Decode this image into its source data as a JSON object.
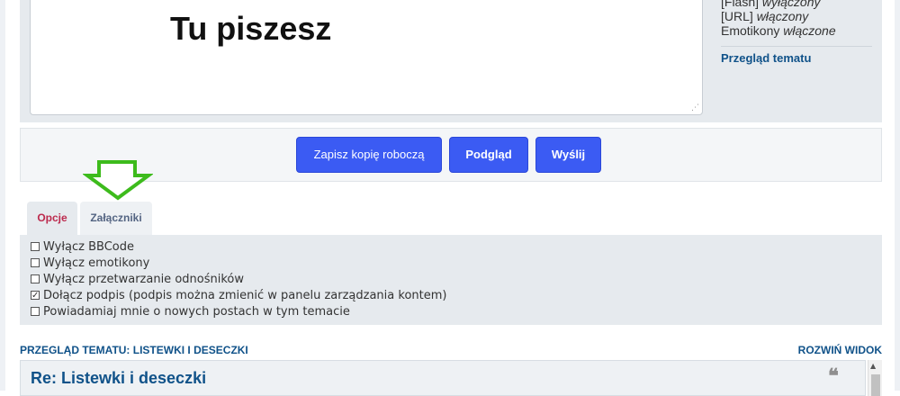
{
  "editor": {
    "text": "Tu piszesz"
  },
  "status": {
    "flash_label": "[Flash]",
    "flash_value": "wyłączony",
    "url_label": "[URL]",
    "url_value": "włączony",
    "emoticons_label": "Emotikony",
    "emoticons_value": "włączone",
    "topic_review_link": "Przegląd tematu"
  },
  "buttons": {
    "save_draft": "Zapisz kopię roboczą",
    "preview": "Podgląd",
    "send": "Wyślij"
  },
  "tabs": [
    {
      "label": "Opcje",
      "active": true
    },
    {
      "label": "Załączniki",
      "active": false
    }
  ],
  "options": [
    {
      "label": "Wyłącz BBCode",
      "checked": false
    },
    {
      "label": "Wyłącz emotikony",
      "checked": false
    },
    {
      "label": "Wyłącz przetwarzanie odnośników",
      "checked": false
    },
    {
      "label": "Dołącz podpis (podpis można zmienić w panelu zarządzania kontem)",
      "checked": true
    },
    {
      "label": "Powiadamiaj mnie o nowych postach w tym temacie",
      "checked": false
    }
  ],
  "review": {
    "title": "PRZEGLĄD TEMATU: LISTEWKI I DESECZKI",
    "expand": "ROZWIŃ WIDOK",
    "post_title": "Re: Listewki i deseczki"
  },
  "colors": {
    "accent_button": "#3b5bf3",
    "link": "#105289",
    "active_tab": "#bc2a4d",
    "arrow": "#3dbb1c"
  }
}
